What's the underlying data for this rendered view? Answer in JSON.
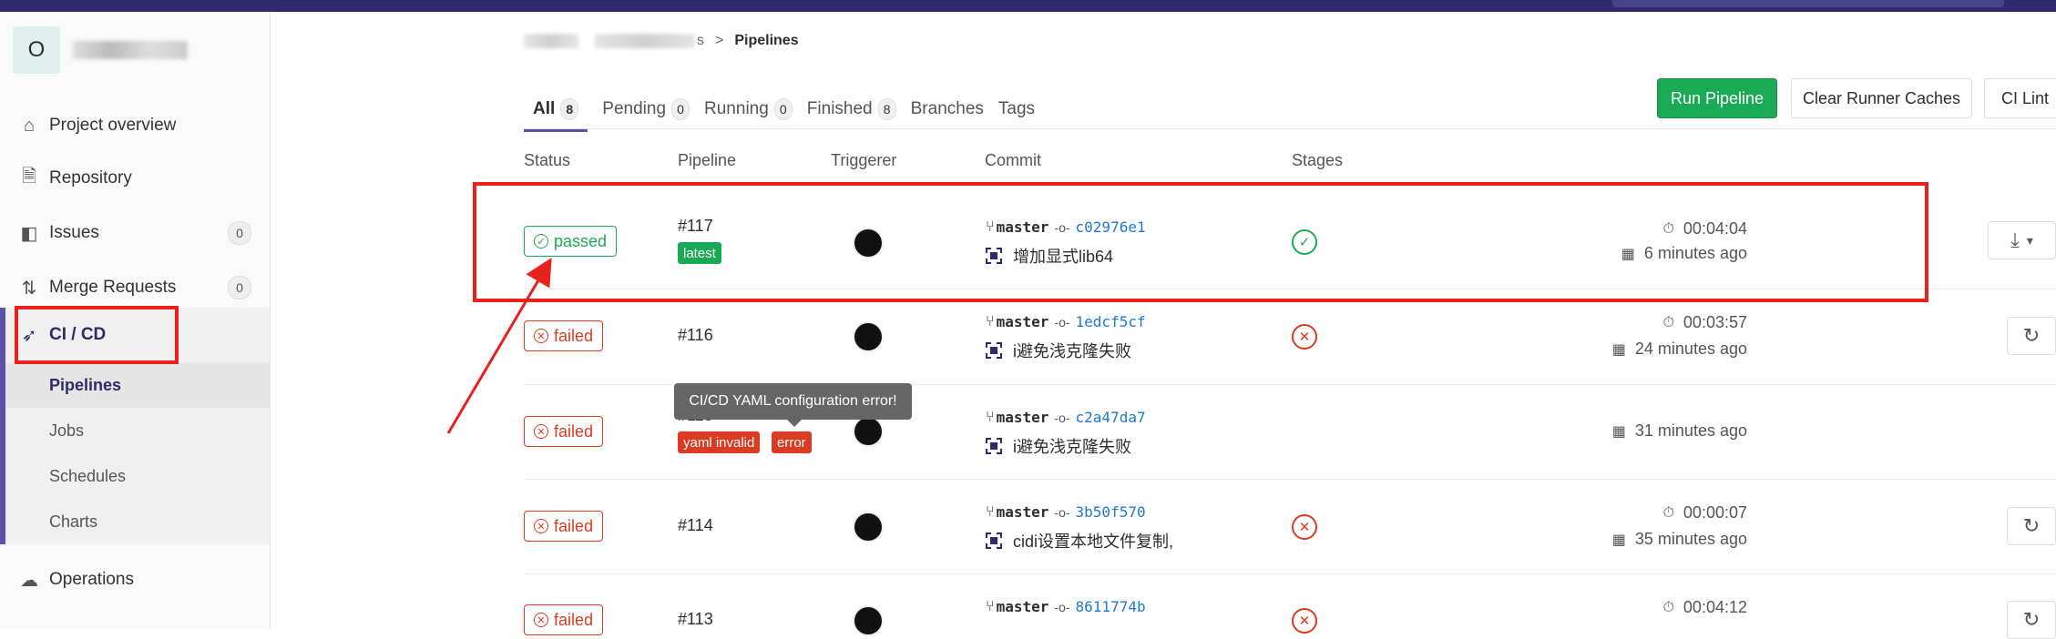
{
  "app": {
    "colors": {
      "accent": "#5b51a8",
      "success": "#1aaa55",
      "danger": "#db3b21",
      "annotation": "#e8211d"
    }
  },
  "sidebar": {
    "project_initial": "O",
    "items": [
      {
        "label": "Project overview",
        "icon": "home-icon"
      },
      {
        "label": "Repository",
        "icon": "document-icon"
      },
      {
        "label": "Issues",
        "icon": "issues-icon",
        "count": "0"
      },
      {
        "label": "Merge Requests",
        "icon": "merge-request-icon",
        "count": "0"
      },
      {
        "label": "CI / CD",
        "icon": "rocket-icon"
      },
      {
        "label": "Operations",
        "icon": "cloud-gear-icon"
      }
    ],
    "ci_sub": [
      "Pipelines",
      "Jobs",
      "Schedules",
      "Charts"
    ]
  },
  "breadcrumb": {
    "separator": ">",
    "current": "Pipelines",
    "partial": "s"
  },
  "tabs": [
    {
      "label": "All",
      "count": "8"
    },
    {
      "label": "Pending",
      "count": "0"
    },
    {
      "label": "Running",
      "count": "0"
    },
    {
      "label": "Finished",
      "count": "8"
    },
    {
      "label": "Branches"
    },
    {
      "label": "Tags"
    }
  ],
  "buttons": {
    "run": "Run Pipeline",
    "clear": "Clear Runner Caches",
    "lint": "CI Lint"
  },
  "columns": {
    "status": "Status",
    "pipeline": "Pipeline",
    "triggerer": "Triggerer",
    "commit": "Commit",
    "stages": "Stages"
  },
  "rows": [
    {
      "status": "passed",
      "id": "#117",
      "badges": [
        "latest"
      ],
      "branch": "master",
      "sha": "c02976e1",
      "message": "增加显式lib64",
      "duration": "00:04:04",
      "finished": "6 minutes ago"
    },
    {
      "status": "failed",
      "id": "#116",
      "branch": "master",
      "sha": "1edcf5cf",
      "message": "i避免浅克隆失败",
      "duration": "00:03:57",
      "finished": "24 minutes ago"
    },
    {
      "status": "failed",
      "id": "#115",
      "badges": [
        "yaml invalid",
        "error"
      ],
      "branch": "master",
      "sha": "c2a47da7",
      "message": "i避免浅克隆失败",
      "finished": "31 minutes ago"
    },
    {
      "status": "failed",
      "id": "#114",
      "branch": "master",
      "sha": "3b50f570",
      "message": "cidi设置本地文件复制,",
      "duration": "00:00:07",
      "finished": "35 minutes ago"
    },
    {
      "status": "failed",
      "id": "#113",
      "branch": "master",
      "sha": "8611774b",
      "duration": "00:04:12"
    }
  ],
  "tooltip": "CI/CD YAML configuration error!"
}
